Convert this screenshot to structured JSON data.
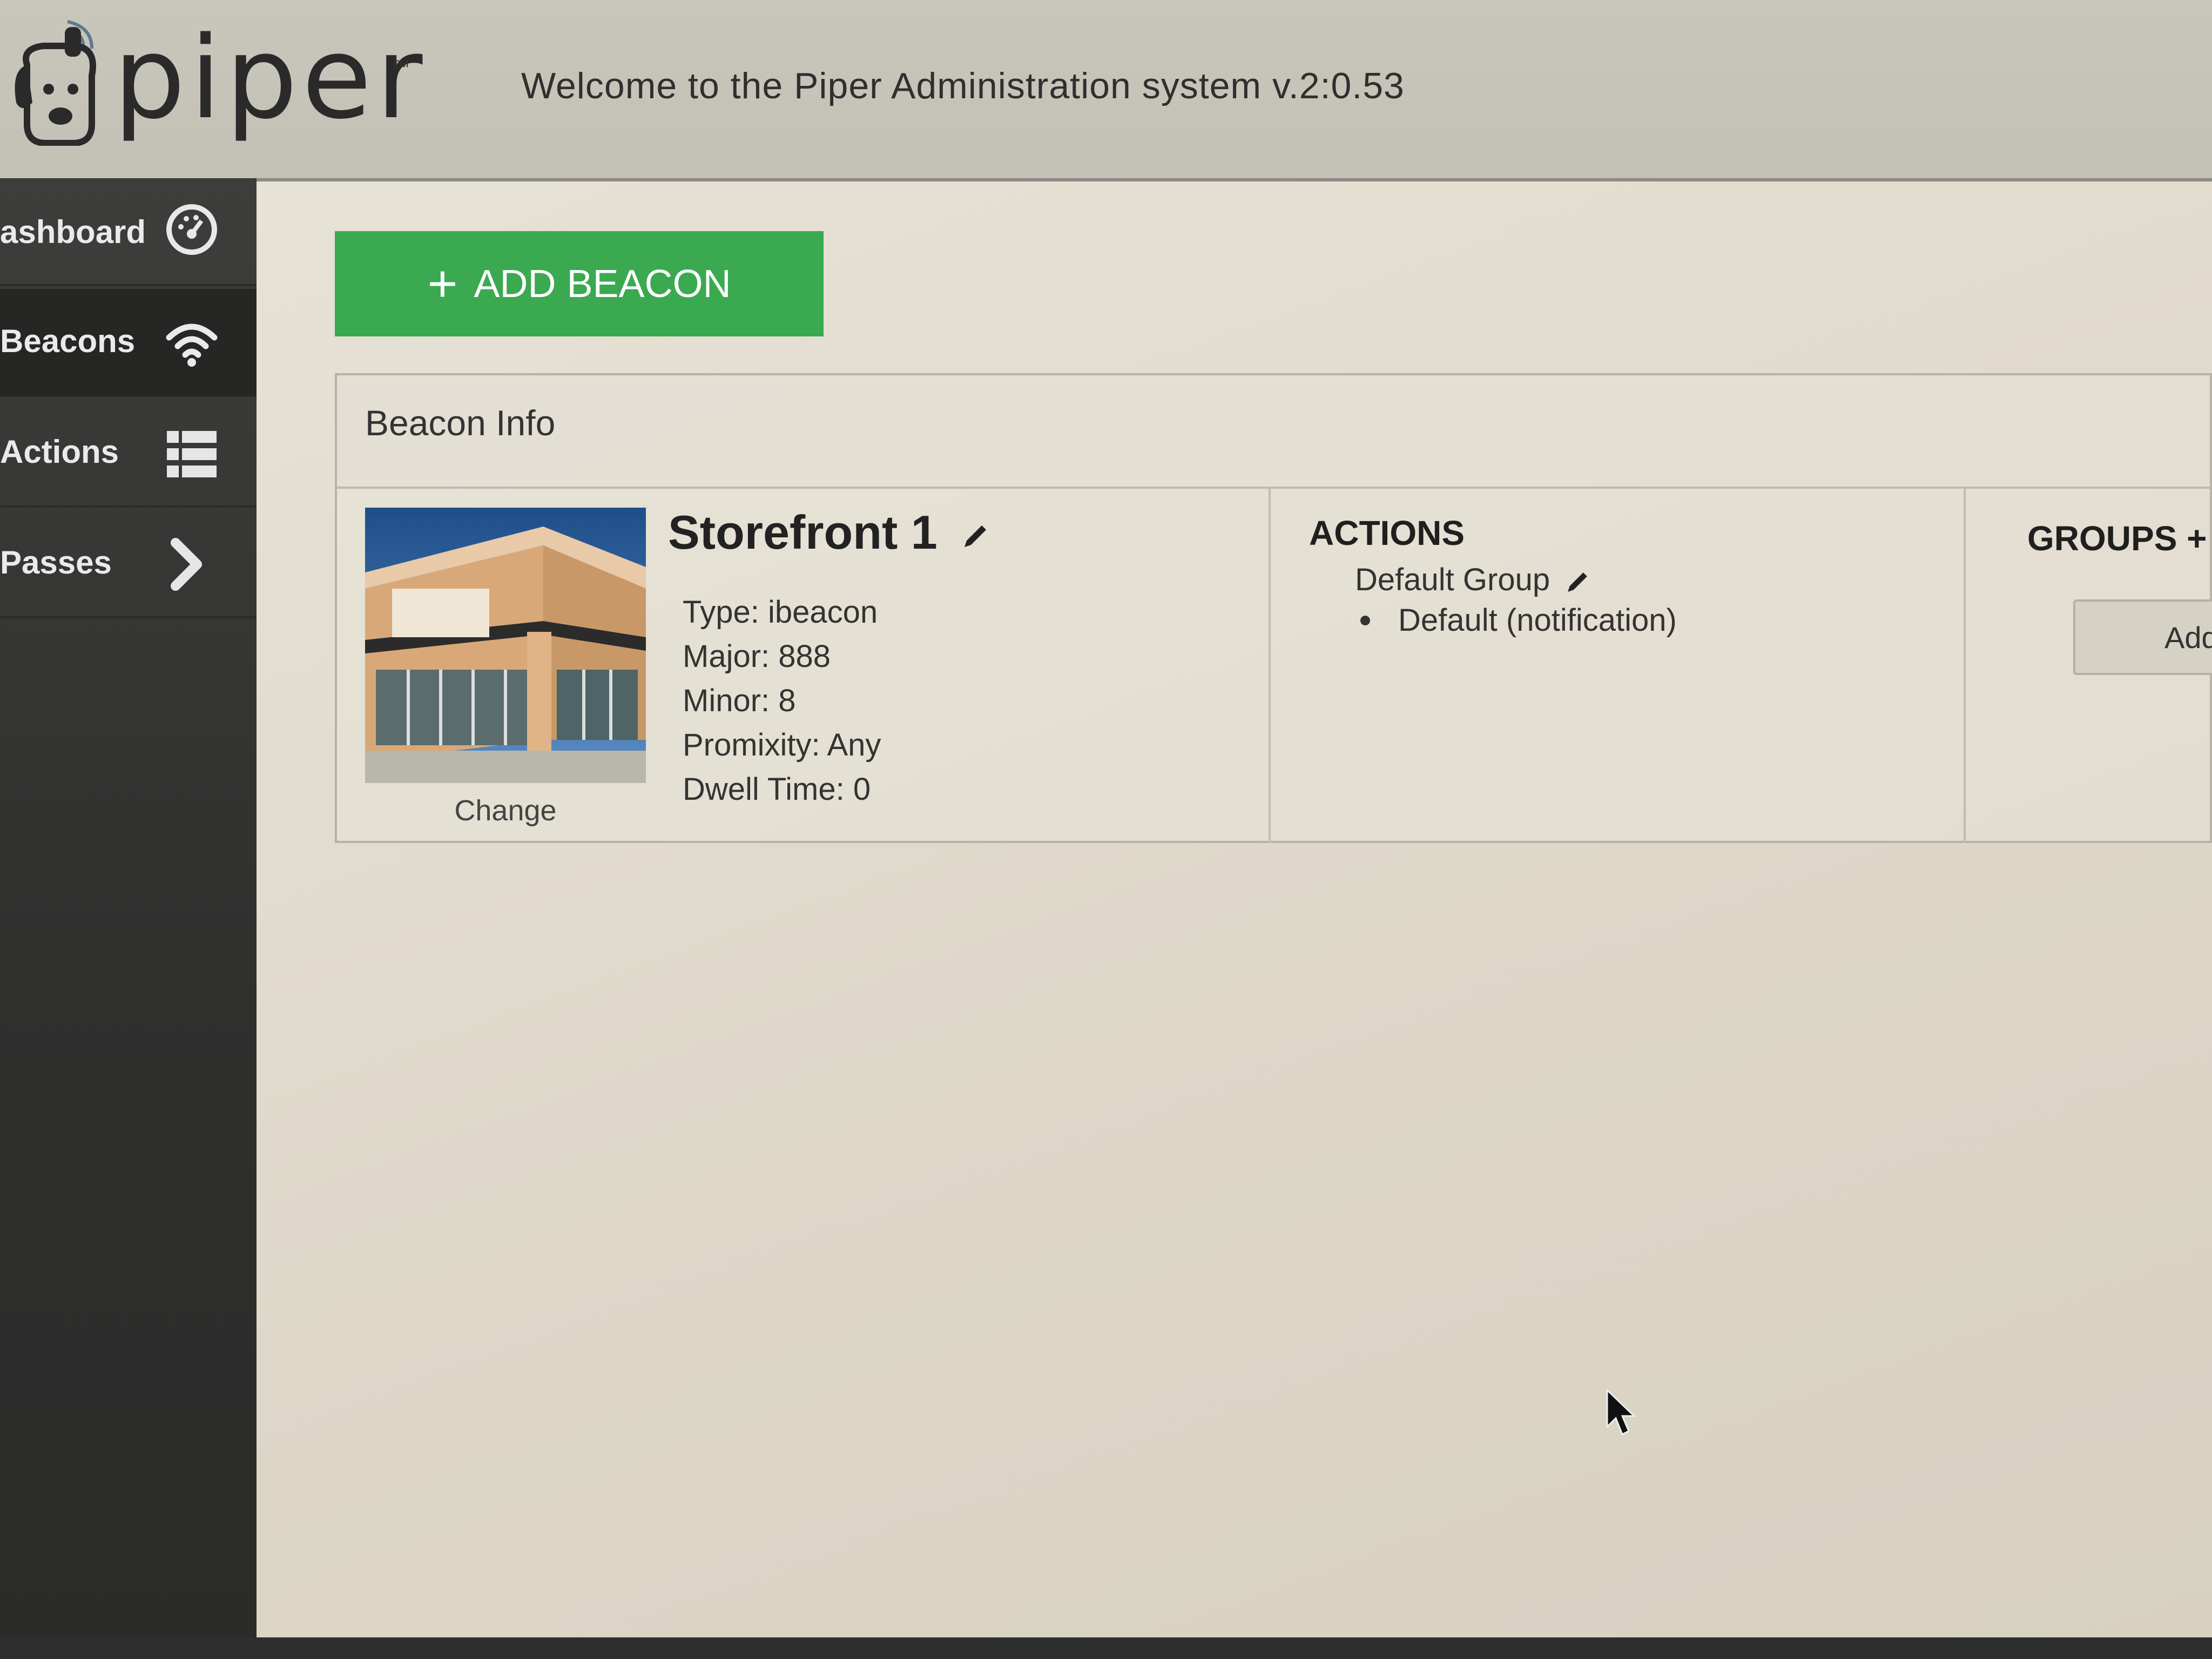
{
  "header": {
    "logo_text": "piper",
    "logo_tm": "™",
    "welcome": "Welcome to the Piper Administration system v.2:0.53"
  },
  "sidebar": {
    "items": [
      {
        "label": "ashboard",
        "icon": "dashboard-gauge-icon"
      },
      {
        "label": "Beacons",
        "icon": "wifi-icon"
      },
      {
        "label": "Actions",
        "icon": "list-icon"
      },
      {
        "label": "Passes",
        "icon": "chevron-right-icon"
      }
    ]
  },
  "toolbar": {
    "add_beacon_label": "ADD BEACON",
    "add_icon": "+"
  },
  "panel": {
    "title": "Beacon Info",
    "beacon": {
      "name": "Storefront 1",
      "change_label": "Change",
      "type": "Type:  ibeacon",
      "major": "Major:  888",
      "minor": "Minor:  8",
      "proximity": "Promixity:  Any",
      "dwell": "Dwell Time:  0"
    },
    "actions": {
      "heading": "ACTIONS",
      "group_name": "Default Group",
      "items": [
        "Default (notification)"
      ]
    },
    "groups": {
      "heading": "GROUPS +",
      "add_button_label": "Add"
    }
  },
  "colors": {
    "accent_green": "#3aa950",
    "sidebar_bg": "#333332",
    "header_bg": "#c6c3b9"
  }
}
